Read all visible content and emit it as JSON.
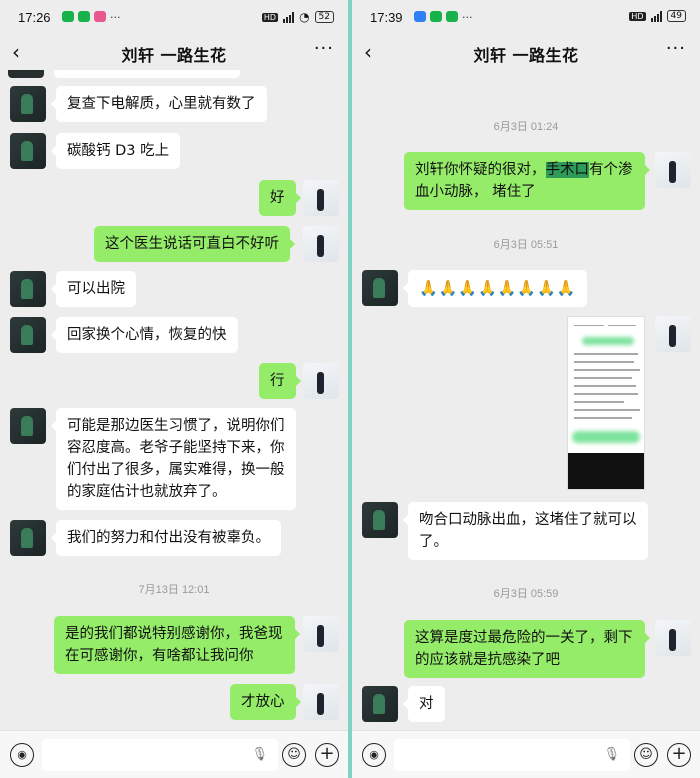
{
  "left": {
    "status": {
      "time": "17:26",
      "battery": "52"
    },
    "title": "刘轩  一路生花",
    "messages": [
      {
        "text": "复查下电解质，心里就有数了"
      },
      {
        "text": "碳酸钙 D3 吃上"
      },
      {
        "text": "好"
      },
      {
        "text": "这个医生说话可直白不好听"
      },
      {
        "text": "可以出院"
      },
      {
        "text": "回家换个心情，恢复的快"
      },
      {
        "text": "行"
      },
      {
        "lines": [
          "可能是那边医生习惯了，说明你们",
          "容忍度高。老爷子能坚持下来，你",
          "们付出了很多，属实难得，换一般",
          "的家庭估计也就放弃了。"
        ]
      },
      {
        "text": "我们的努力和付出没有被辜负。"
      },
      {
        "lines": [
          "是的我们都说特别感谢你，我爸现",
          "在可感谢你，有啥都让我问你"
        ]
      },
      {
        "text": "才放心"
      }
    ],
    "timestamp": "7月13日 12:01"
  },
  "right": {
    "status": {
      "time": "17:39",
      "battery": "49"
    },
    "title": "刘轩  一路生花",
    "timestamps": [
      "6月3日 01:24",
      "6月3日 05:51",
      "6月3日 05:59"
    ],
    "messages": [
      {
        "line1_a": "刘轩你怀疑的很对，",
        "line1_hl": "手术口",
        "line1_b": "有个渗",
        "line2": "血小动脉，  堵住了"
      },
      {
        "text": "🙏🙏🙏🙏🙏🙏🙏🙏"
      },
      {
        "lines": [
          "吻合口动脉出血，这堵住了就可以",
          "了。"
        ]
      },
      {
        "lines": [
          "这算是度过最危险的一关了，剩下",
          "的应该就是抗感染了吧"
        ]
      },
      {
        "text": "对"
      }
    ]
  },
  "icons": {
    "back": "‹",
    "more": "···",
    "voice": "voice-icon",
    "emoji": "emoji-icon",
    "plus": "+",
    "mic": "mic-icon"
  },
  "colors": {
    "out_bubble": "#95ec69",
    "in_bubble": "#ffffff",
    "bg": "#ededed",
    "divider": "#7fd3c4"
  }
}
